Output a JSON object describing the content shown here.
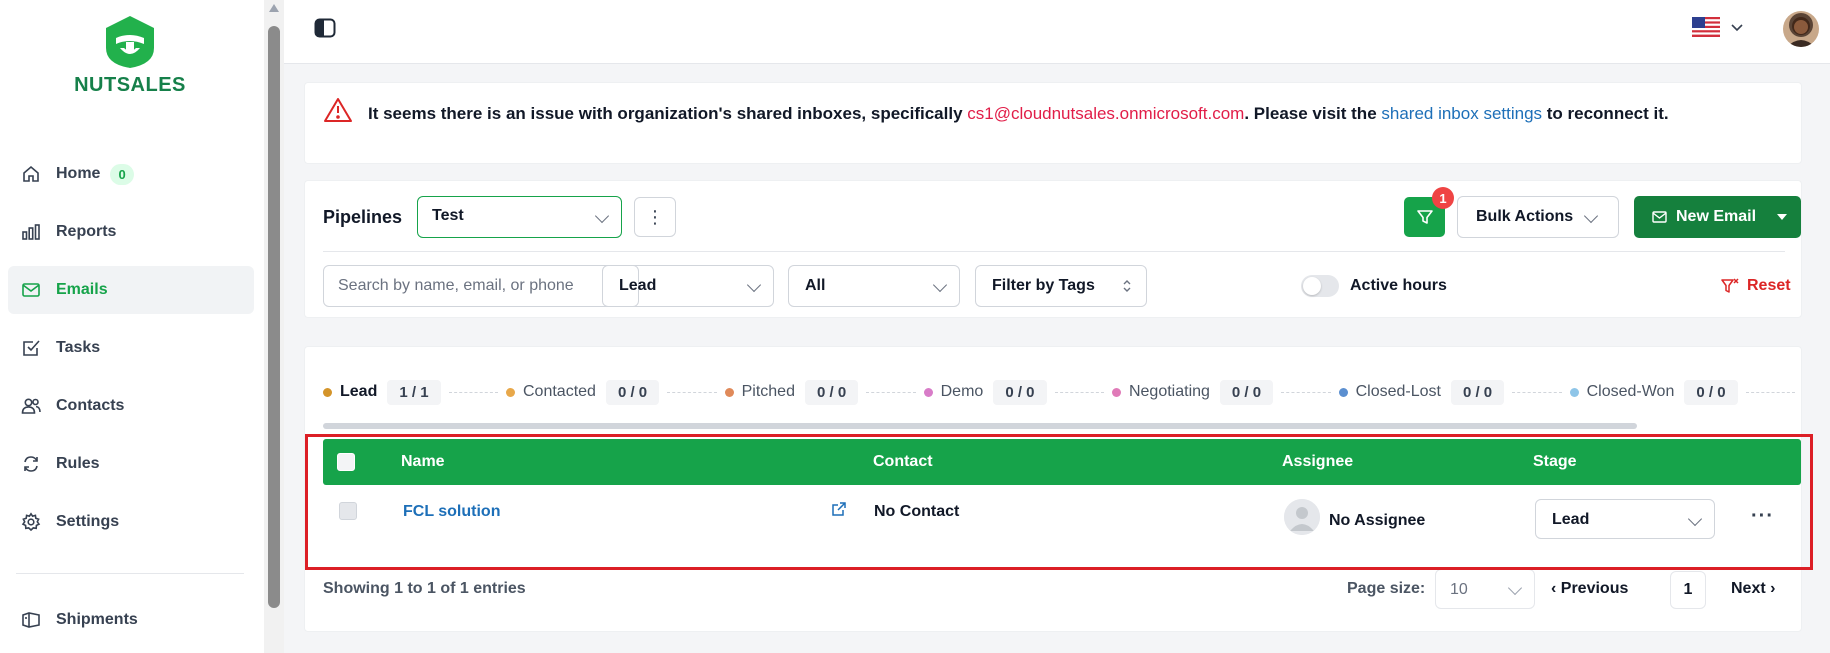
{
  "app": {
    "name": "NUTSALES",
    "brand_color": "#16a34a"
  },
  "sidebar": {
    "items": [
      {
        "label": "Home",
        "icon": "home-icon",
        "badge": "0"
      },
      {
        "label": "Reports",
        "icon": "bar-chart-icon"
      },
      {
        "label": "Emails",
        "icon": "mail-icon",
        "active": true
      },
      {
        "label": "Tasks",
        "icon": "check-square-icon"
      },
      {
        "label": "Contacts",
        "icon": "users-icon"
      },
      {
        "label": "Rules",
        "icon": "refresh-icon"
      },
      {
        "label": "Settings",
        "icon": "gear-icon"
      }
    ],
    "bottom_items": [
      {
        "label": "Shipments",
        "icon": "box-icon"
      }
    ]
  },
  "alert": {
    "text_before": "It seems there is an issue with organization's shared inboxes, specifically ",
    "email": "cs1@cloudnutsales.onmicrosoft.com",
    "text_middle": ". Please visit the ",
    "link": "shared inbox settings",
    "text_after": " to reconnect it."
  },
  "pipelines": {
    "label": "Pipelines",
    "selected": "Test",
    "filter_badge": "1",
    "bulk_actions_label": "Bulk Actions",
    "new_email_label": "New Email"
  },
  "filters": {
    "search_placeholder": "Search by name, email, or phone",
    "stage_filter": "Lead",
    "status_filter": "All",
    "tags_filter": "Filter by Tags",
    "active_hours_label": "Active hours",
    "reset_label": "Reset"
  },
  "stages": [
    {
      "name": "Lead",
      "count": "1 / 1",
      "color": "#d4942a",
      "active": true
    },
    {
      "name": "Contacted",
      "count": "0 / 0",
      "color": "#e8a84a"
    },
    {
      "name": "Pitched",
      "count": "0 / 0",
      "color": "#e08a5a"
    },
    {
      "name": "Demo",
      "count": "0 / 0",
      "color": "#d87cc8"
    },
    {
      "name": "Negotiating",
      "count": "0 / 0",
      "color": "#e07ab8"
    },
    {
      "name": "Closed-Lost",
      "count": "0 / 0",
      "color": "#5b8fd0"
    },
    {
      "name": "Closed-Won",
      "count": "0 / 0",
      "color": "#8ec5e8"
    }
  ],
  "table": {
    "columns": {
      "name": "Name",
      "contact": "Contact",
      "assignee": "Assignee",
      "stage": "Stage"
    },
    "rows": [
      {
        "name": "FCL solution",
        "contact": "No Contact",
        "assignee": "No Assignee",
        "stage": "Lead"
      }
    ]
  },
  "pagination": {
    "showing": "Showing 1 to 1 of 1 entries",
    "page_size_label": "Page size:",
    "page_size": "10",
    "previous_label": "Previous",
    "current_page": "1",
    "next_label": "Next"
  }
}
